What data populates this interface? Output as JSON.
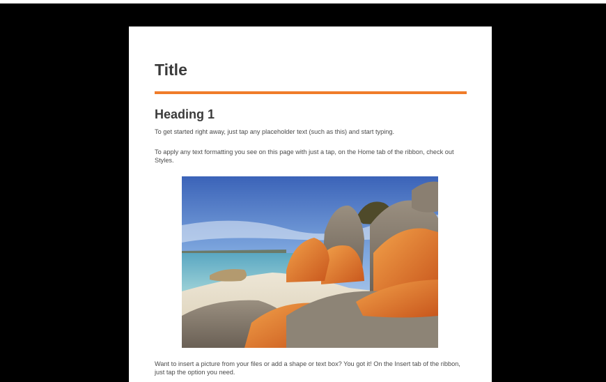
{
  "document": {
    "title": "Title",
    "heading1": "Heading 1",
    "paragraphs": [
      "To get started right away, just tap any placeholder text (such as this) and start typing.",
      "To apply any text formatting you see on this page with just a tap, on the Home tab of the ribbon, check out Styles.",
      "Want to insert a picture from your files or add a shape or text box? You got it! On the Insert tab of the ribbon, just tap the option you need."
    ]
  },
  "colors": {
    "background": "#000000",
    "page": "#ffffff",
    "accent_rule": "#f07c2a",
    "title_text": "#3a3a3a",
    "body_text": "#4a4a4a"
  }
}
